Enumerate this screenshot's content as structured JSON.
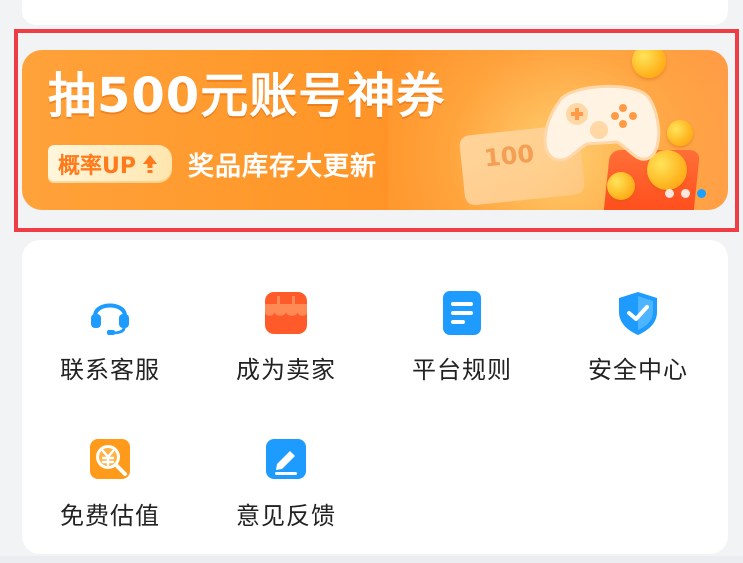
{
  "banner": {
    "title": "抽500元账号神券",
    "badge_text": "概率UP",
    "subtitle": "奖品库存大更新",
    "coupon_value": "100",
    "carousel": {
      "count": 3,
      "active_index": 2
    }
  },
  "colors": {
    "highlight": "#ef3d45",
    "banner_orange": "#ff9628",
    "active_dot": "#1aa0ff"
  },
  "services": [
    {
      "label": "联系客服",
      "icon": "headset-icon"
    },
    {
      "label": "成为卖家",
      "icon": "shop-icon"
    },
    {
      "label": "平台规则",
      "icon": "document-icon"
    },
    {
      "label": "安全中心",
      "icon": "shield-check-icon"
    },
    {
      "label": "免费估值",
      "icon": "valuation-icon"
    },
    {
      "label": "意见反馈",
      "icon": "feedback-icon"
    }
  ]
}
